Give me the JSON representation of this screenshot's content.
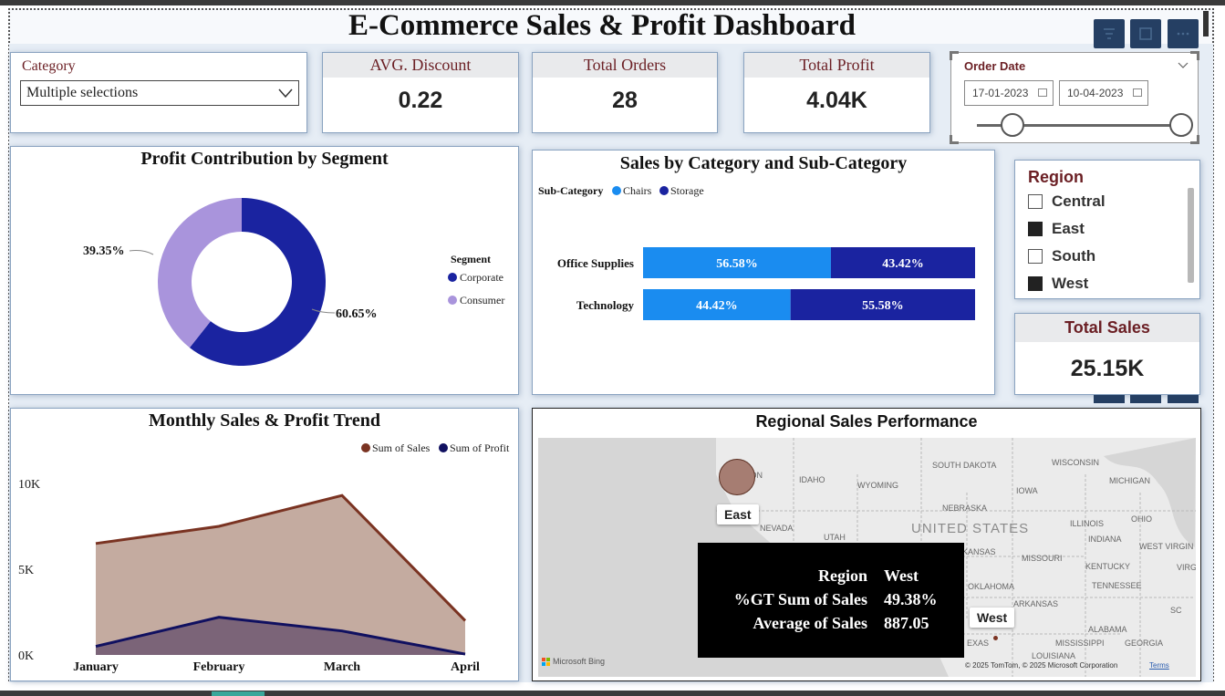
{
  "title": "E-Commerce Sales & Profit Dashboard",
  "header_buttons": [
    "filter-icon",
    "focus-icon",
    "more-icon"
  ],
  "category_slicer": {
    "label": "Category",
    "value": "Multiple selections"
  },
  "kpis": {
    "avg_discount": {
      "label": "AVG. Discount",
      "value": "0.22"
    },
    "total_orders": {
      "label": "Total Orders",
      "value": "28"
    },
    "total_profit": {
      "label": "Total Profit",
      "value": "4.04K"
    },
    "total_sales": {
      "label": "Total Sales",
      "value": "25.15K"
    }
  },
  "order_date": {
    "label": "Order Date",
    "start": "17-01-2023",
    "end": "10-04-2023",
    "range_fraction": [
      0.0,
      1.0
    ]
  },
  "region_slicer": {
    "title": "Region",
    "items": [
      {
        "label": "Central",
        "checked": false
      },
      {
        "label": "East",
        "checked": true
      },
      {
        "label": "South",
        "checked": false
      },
      {
        "label": "West",
        "checked": true
      }
    ]
  },
  "segment_chart": {
    "title": "Profit Contribution by Segment",
    "legend_title": "Segment",
    "chart_data": {
      "type": "pie",
      "labels": [
        "Corporate",
        "Consumer"
      ],
      "values": [
        60.65,
        39.35
      ],
      "value_labels": [
        "60.65%",
        "39.35%"
      ],
      "colors": [
        "#1a23a0",
        "#a994dc"
      ],
      "legend": "right"
    }
  },
  "category_chart": {
    "title": "Sales by Category and Sub-Category",
    "legend_title": "Sub-Category",
    "chart_data": {
      "type": "bar",
      "orientation": "horizontal-stacked-100",
      "categories": [
        "Office Supplies",
        "Technology"
      ],
      "series": [
        {
          "name": "Chairs",
          "values": [
            56.58,
            44.42
          ],
          "labels": [
            "56.58%",
            "44.42%"
          ],
          "color": "#1a8cf0"
        },
        {
          "name": "Storage",
          "values": [
            43.42,
            55.58
          ],
          "labels": [
            "43.42%",
            "55.58%"
          ],
          "color": "#1a23a0"
        }
      ],
      "legend": "top-left"
    }
  },
  "trend_chart": {
    "title": "Monthly Sales & Profit Trend",
    "chart_data": {
      "type": "area",
      "categories": [
        "January",
        "February",
        "March",
        "April"
      ],
      "series": [
        {
          "name": "Sum of Sales",
          "values": [
            6500,
            7500,
            9300,
            2000
          ],
          "color": "#7a3322",
          "fill": "#c4aba0"
        },
        {
          "name": "Sum of Profit",
          "values": [
            500,
            2200,
            1400,
            50
          ],
          "color": "#101060",
          "fill": "#7b6478"
        }
      ],
      "y_ticks": [
        "10K",
        "5K",
        "0K"
      ],
      "ylim": [
        0,
        10000
      ],
      "legend": "top-right"
    }
  },
  "map": {
    "title": "Regional Sales Performance",
    "state_labels": [
      "SOUTH DAKOTA",
      "WISCONSIN",
      "MICHIGAN",
      "OREGON",
      "IDAHO",
      "WYOMING",
      "IOWA",
      "NEBRASKA",
      "NEVADA",
      "UTAH",
      "UNITED STATES",
      "ILLINOIS",
      "OHIO",
      "INDIANA",
      "WEST VIRGIN",
      "KANSAS",
      "MISSOURI",
      "KENTUCKY",
      "VIRG",
      "TENNESSEE",
      "OKLAHOMA",
      "ARKANSAS",
      "SC",
      "ALABAMA",
      "MISSISSIPPI",
      "GEORGIA",
      "EXAS",
      "LOUISIANA"
    ],
    "markers": [
      {
        "label": "East"
      },
      {
        "label": "West"
      }
    ],
    "tooltip": [
      {
        "key": "Region",
        "value": "West"
      },
      {
        "key": "%GT Sum of Sales",
        "value": "49.38%"
      },
      {
        "key": "Average of Sales",
        "value": "887.05"
      }
    ],
    "bing": "Microsoft Bing",
    "copyright": "© 2025 TomTom, © 2025 Microsoft Corporation",
    "terms": "Terms"
  }
}
